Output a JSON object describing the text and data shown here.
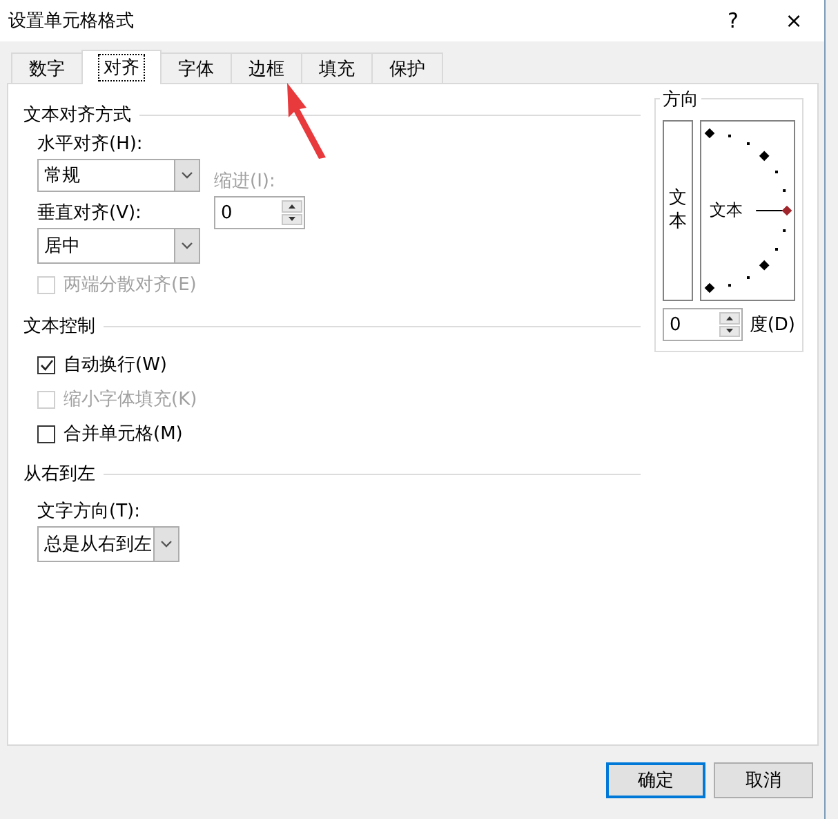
{
  "window": {
    "title": "设置单元格格式",
    "help": "?",
    "close": "×"
  },
  "tabs": [
    {
      "label": "数字",
      "selected": false
    },
    {
      "label": "对齐",
      "selected": true
    },
    {
      "label": "字体",
      "selected": false
    },
    {
      "label": "边框",
      "selected": false
    },
    {
      "label": "填充",
      "selected": false
    },
    {
      "label": "保护",
      "selected": false
    }
  ],
  "alignment": {
    "heading": "文本对齐方式",
    "horizontal": {
      "label": "水平对齐(H):",
      "value": "常规"
    },
    "vertical": {
      "label": "垂直对齐(V):",
      "value": "居中"
    },
    "indent": {
      "label": "缩进(I):",
      "value": "0",
      "disabled": true
    },
    "justify_distributed": {
      "label": "两端分散对齐(E)",
      "checked": false,
      "disabled": true
    }
  },
  "text_control": {
    "heading": "文本控制",
    "options": [
      {
        "label": "自动换行(W)",
        "checked": true,
        "disabled": false
      },
      {
        "label": "缩小字体填充(K)",
        "checked": false,
        "disabled": true
      },
      {
        "label": "合并单元格(M)",
        "checked": false,
        "disabled": false
      }
    ]
  },
  "right_to_left": {
    "heading": "从右到左",
    "direction": {
      "label": "文字方向(T):",
      "value": "总是从右到左"
    }
  },
  "orientation": {
    "heading": "方向",
    "vertical_text": "文本",
    "dial_text": "文本",
    "degrees": {
      "value": "0",
      "label": "度(D)"
    }
  },
  "buttons": [
    {
      "label": "确定",
      "default": true
    },
    {
      "label": "取消",
      "default": false
    }
  ]
}
